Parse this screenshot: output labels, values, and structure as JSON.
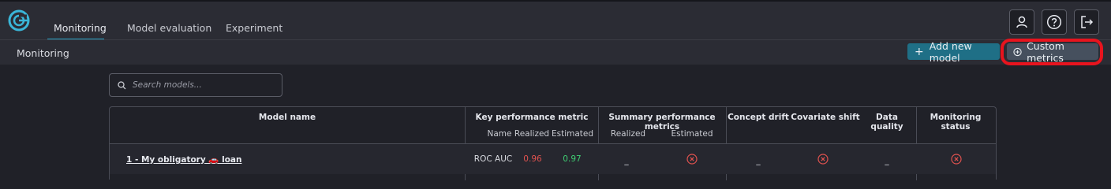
{
  "nav": {
    "tabs": [
      {
        "label": "Monitoring",
        "active": true
      },
      {
        "label": "Model evaluation",
        "active": false
      },
      {
        "label": "Experiment",
        "active": false
      }
    ],
    "icons": [
      "user-icon",
      "help-icon",
      "logout-icon"
    ]
  },
  "subbar": {
    "title": "Monitoring",
    "add_model_label": "Add new model",
    "custom_metrics_label": "Custom metrics"
  },
  "search": {
    "placeholder": "Search models..."
  },
  "table": {
    "headers": {
      "model_name": "Model name",
      "key_performance": "Key performance metric",
      "summary_performance": "Summary performance metrics",
      "concept_drift": "Concept drift",
      "covariate_shift": "Covariate shift",
      "data_quality": "Data quality",
      "monitoring_status": "Monitoring status"
    },
    "subheaders": {
      "kp_name": "Name",
      "kp_realized": "Realized",
      "kp_estimated": "Estimated",
      "sp_realized": "Realized",
      "sp_estimated": "Estimated"
    },
    "rows": [
      {
        "model_name": "1 - My obligatory 🚗 loan",
        "kp_name": "ROC AUC",
        "kp_realized": "0.96",
        "kp_estimated": "0.97",
        "sp_realized": "_",
        "sp_estimated_icon": "x-circle-icon",
        "concept_drift": "_",
        "covariate_shift_icon": "x-circle-icon",
        "data_quality": "_",
        "monitoring_status_icon": "x-circle-icon"
      }
    ]
  },
  "colors": {
    "accent": "#2aa4c7",
    "primary_button": "#1f6f86",
    "highlight": "#e8141e",
    "bad": "#e0524f",
    "good": "#3fcf73"
  }
}
